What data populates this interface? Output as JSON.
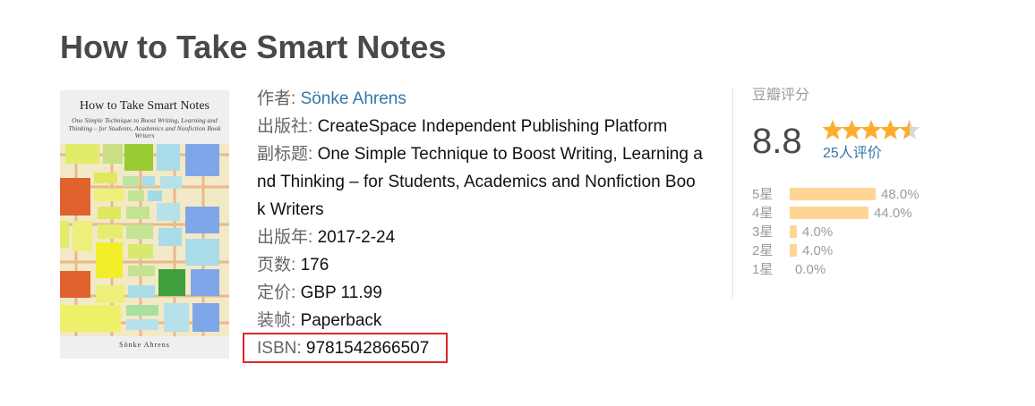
{
  "book": {
    "title": "How to Take Smart Notes"
  },
  "cover": {
    "title": "How to Take Smart Notes",
    "subtitle": "One Simple Technique to Boost Writing, Learning and Thinking – for Students, Academics and Nonfiction Book Writers",
    "author": "Sönke Ahrens"
  },
  "info": {
    "author_label": "作者:",
    "author_value": "Sönke Ahrens",
    "publisher_label": "出版社:",
    "publisher_value": "CreateSpace Independent Publishing Platform",
    "subtitle_label": "副标题:",
    "subtitle_value": "One Simple Technique to Boost Writing, Learning and Thinking – for Students, Academics and Nonfiction Book Writers",
    "pubdate_label": "出版年:",
    "pubdate_value": "2017-2-24",
    "pages_label": "页数:",
    "pages_value": "176",
    "price_label": "定价:",
    "price_value": "GBP 11.99",
    "binding_label": "装帧:",
    "binding_value": "Paperback",
    "isbn_label": "ISBN:",
    "isbn_value": "9781542866507"
  },
  "rating": {
    "heading": "豆瓣评分",
    "score": "8.8",
    "stars": 4.5,
    "votes": "25人评价",
    "distribution": [
      {
        "label": "5星",
        "percent": 48.0,
        "percent_text": "48.0%"
      },
      {
        "label": "4星",
        "percent": 44.0,
        "percent_text": "44.0%"
      },
      {
        "label": "3星",
        "percent": 4.0,
        "percent_text": "4.0%"
      },
      {
        "label": "2星",
        "percent": 4.0,
        "percent_text": "4.0%"
      },
      {
        "label": "1星",
        "percent": 0.0,
        "percent_text": "0.0%"
      }
    ]
  },
  "colors": {
    "link": "#3377aa",
    "star": "#ffac2d",
    "bar": "#ffd596",
    "highlight_box": "#e0262b"
  }
}
